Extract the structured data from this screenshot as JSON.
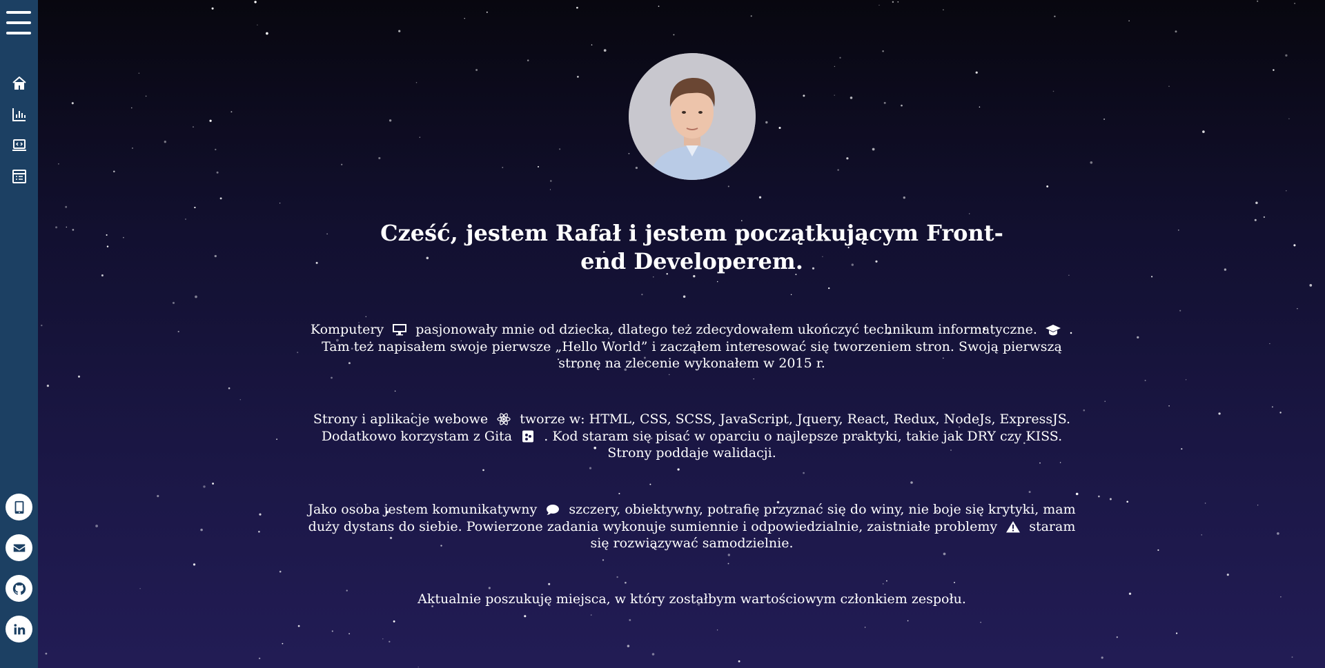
{
  "sidebar": {
    "nav": [
      {
        "icon": "home-icon"
      },
      {
        "icon": "chart-icon"
      },
      {
        "icon": "laptop-code-icon"
      },
      {
        "icon": "checklist-icon"
      }
    ],
    "social": [
      {
        "icon": "phone-icon"
      },
      {
        "icon": "mail-icon"
      },
      {
        "icon": "github-icon"
      },
      {
        "icon": "linkedin-icon"
      }
    ]
  },
  "hero": {
    "headline": "Cześć, jestem Rafał i jestem początkującym Front-end Developerem."
  },
  "about": {
    "p1": {
      "a": "Komputery",
      "b": "pasjonowały mnie od dziecka, dlatego też zdecydowałem ukończyć technikum informatyczne.",
      "c": ". Tam też napisałem swoje pierwsze „Hello World” i zacząłem interesować się tworzeniem stron. Swoją pierwszą stronę na zlecenie wykonałem w 2015 r."
    },
    "p2": {
      "a": "Strony i aplikacje webowe",
      "b": "tworze w: HTML, CSS, SCSS, JavaScript, Jquery, React, Redux, NodeJs, ExpressJS. Dodatkowo korzystam z Gita",
      "c": ". Kod staram się pisać w oparciu o najlepsze praktyki, takie jak DRY czy KISS. Strony poddaje walidacji."
    },
    "p3": {
      "a": "Jako osoba jestem komunikatywny",
      "b": "szczery, obiektywny, potrafię przyznać się do winy, nie boje się krytyki, mam duży dystans do siebie. Powierzone zadania wykonuje sumiennie i odpowiedzialnie, zaistniałe problemy",
      "c": "staram się rozwiązywać samodzielnie."
    },
    "p4": "Aktualnie poszukuję miejsca, w który zostałbym wartościowym członkiem zespołu."
  },
  "colors": {
    "sidebar": "#1c4063",
    "background_top": "#08070f",
    "background_bottom": "#221c55",
    "text": "#ffffff"
  }
}
